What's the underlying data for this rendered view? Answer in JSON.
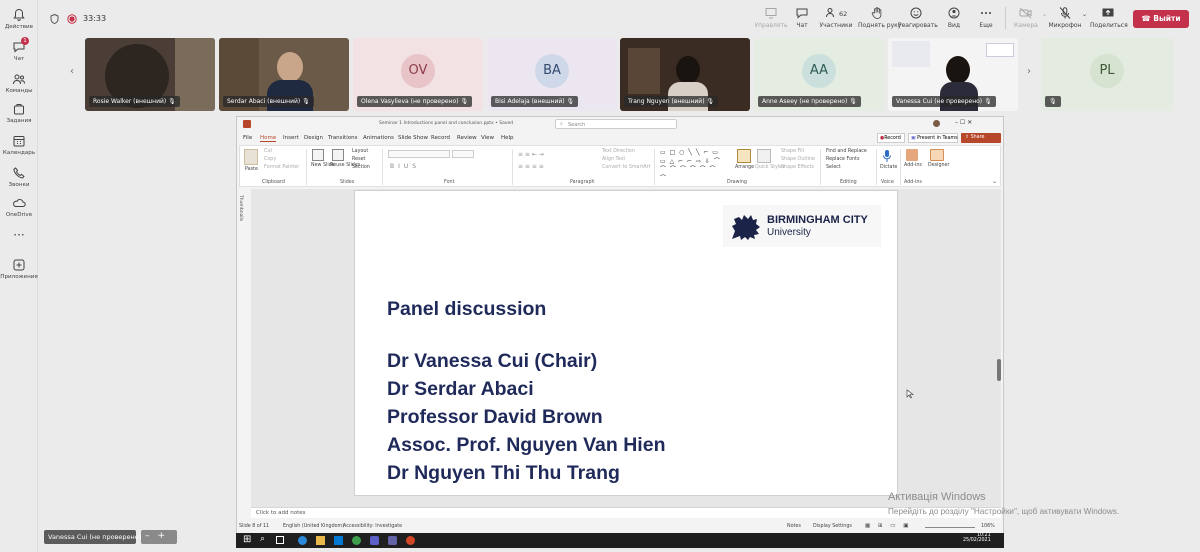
{
  "rail": {
    "items": [
      {
        "label": "Действие",
        "icon": "bell-icon"
      },
      {
        "label": "Чат",
        "icon": "chat-icon",
        "badge": "1"
      },
      {
        "label": "Команды",
        "icon": "teams-icon"
      },
      {
        "label": "Задания",
        "icon": "assignments-icon"
      },
      {
        "label": "Календарь",
        "icon": "calendar-icon"
      },
      {
        "label": "Звонки",
        "icon": "phone-icon"
      },
      {
        "label": "OneDrive",
        "icon": "cloud-icon"
      },
      {
        "label": "",
        "icon": "more-icon"
      },
      {
        "label": "Приложения",
        "icon": "apps-icon"
      }
    ]
  },
  "meeting": {
    "timer": "33:33",
    "toolbar": {
      "control": "Управлять",
      "chat": "Чат",
      "participants": "Участники",
      "participants_count": "62",
      "raise_hand": "Поднять руку",
      "react": "Реагировать",
      "view": "Вид",
      "more": "Еще",
      "camera": "Камера",
      "mic": "Микрофон",
      "share": "Поделиться",
      "leave": "Выйти"
    }
  },
  "participants": [
    {
      "name": "Rosie Walker (внешний)",
      "type": "video"
    },
    {
      "name": "Serdar Abaci (внешний)",
      "type": "video"
    },
    {
      "name": "Olena Vasylieva (не проверено)",
      "initials": "OV",
      "type": "avatar"
    },
    {
      "name": "Bisi Adelaja (внешний)",
      "initials": "BA",
      "type": "avatar"
    },
    {
      "name": "Trang Nguyen (внешний)",
      "type": "video"
    },
    {
      "name": "Anne Aseey (не проверено)",
      "initials": "AA",
      "type": "avatar"
    },
    {
      "name": "Vanessa Cui (не проверено)",
      "type": "video"
    },
    {
      "name": "",
      "initials": "PL",
      "type": "avatar"
    }
  ],
  "self_label": "Vanessa Cui (не проверено)",
  "ppt": {
    "title": "Seminar 1 Introductions panel and conclusion.pptx • Saved",
    "search_placeholder": "Search",
    "record": "Record",
    "present_in_teams": "Present in Teams",
    "share": "Share",
    "menu": [
      "File",
      "Home",
      "Insert",
      "Design",
      "Transitions",
      "Animations",
      "Slide Show",
      "Record",
      "Review",
      "View",
      "Help"
    ],
    "ribbon_groups": [
      "Clipboard",
      "Slides",
      "Font",
      "Paragraph",
      "Drawing",
      "Editing",
      "Voice",
      "Add-ins"
    ],
    "ribbon": {
      "paste": "Paste",
      "new_slide": "New Slide",
      "reuse_slides": "Reuse Slides",
      "layout": "Layout",
      "reset": "Reset",
      "section": "Section",
      "cut": "Cut",
      "copy": "Copy",
      "format_painter": "Format Painter",
      "text_direction": "Text Direction",
      "align_text": "Align Text",
      "convert_smartart": "Convert to SmartArt",
      "arrange": "Arrange",
      "quick_styles": "Quick Styles",
      "shape_fill": "Shape Fill",
      "shape_outline": "Shape Outline",
      "shape_effects": "Shape Effects",
      "find_replace": "Find and Replace",
      "replace_fonts": "Replace Fonts",
      "select": "Select",
      "dictate": "Dictate",
      "add_ins": "Add-ins",
      "designer": "Designer"
    },
    "thumbnails_label": "Thumbnails",
    "slide": {
      "logo_line1": "BIRMINGHAM CITY",
      "logo_line2": "University",
      "heading": "Panel discussion",
      "lines": [
        "Dr Vanessa Cui (Chair)",
        "Dr Serdar Abaci",
        "Professor David Brown",
        "Assoc. Prof. Nguyen Van Hien",
        "Dr Nguyen Thi Thu Trang"
      ]
    },
    "notes_placeholder": "Click to add notes",
    "status": {
      "slide_of": "Slide 8 of 11",
      "language": "English (United Kingdom)",
      "accessibility": "Accessibility: Investigate",
      "notes": "Notes",
      "display_settings": "Display Settings",
      "zoom": "106%"
    }
  },
  "taskbar": {
    "time": "10:21",
    "date": "25/02/2021"
  },
  "watermark": {
    "line1": "Активація Windows",
    "line2": "Перейдіть до розділу \"Настройки\", щоб активувати Windows."
  },
  "colors": {
    "teams_red": "#c4314b",
    "ppt_accent": "#b7472a",
    "slide_text": "#1f2a5a"
  }
}
